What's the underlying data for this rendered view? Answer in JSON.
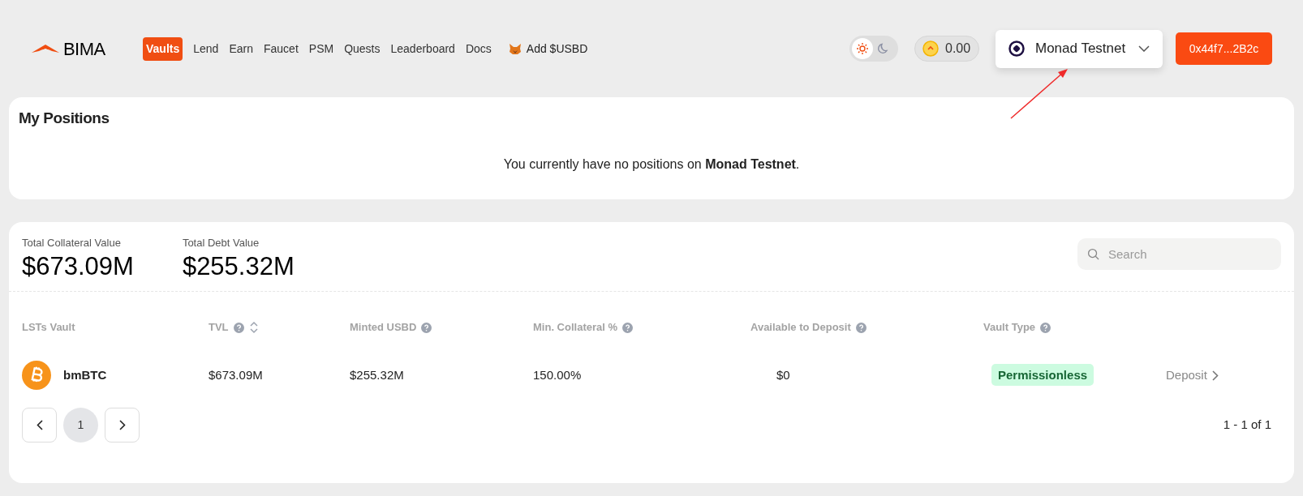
{
  "brand": "BIMA",
  "nav": [
    {
      "label": "Vaults",
      "selected": true
    },
    {
      "label": "Lend",
      "selected": false
    },
    {
      "label": "Earn",
      "selected": false
    },
    {
      "label": "Faucet",
      "selected": false
    },
    {
      "label": "PSM",
      "selected": false
    },
    {
      "label": "Quests",
      "selected": false
    },
    {
      "label": "Leaderboard",
      "selected": false
    },
    {
      "label": "Docs",
      "selected": false
    }
  ],
  "add_token": "Add $USBD",
  "dark_mode": false,
  "balance": "0.00",
  "network": "Monad Testnet",
  "wallet": "0x44f7...2B2c",
  "positions": {
    "title": "My Positions",
    "message": "You currently have no positions on **Monad Testnet**."
  },
  "stats": [
    {
      "label": "Total Collateral Value",
      "value": "$673.09M"
    },
    {
      "label": "Total Debt Value",
      "value": "$255.32M"
    }
  ],
  "search": {
    "placeholder": "Search"
  },
  "table": {
    "columns": [
      {
        "label": "LSTs Vault",
        "help": false,
        "sortable": false
      },
      {
        "label": "TVL",
        "help": true,
        "sortable": true
      },
      {
        "label": "Minted USBD",
        "help": true,
        "sortable": false
      },
      {
        "label": "Min. Collateral %",
        "help": true,
        "sortable": false
      },
      {
        "label": "Available to Deposit",
        "help": true,
        "sortable": false
      },
      {
        "label": "Vault Type",
        "help": true,
        "sortable": false
      }
    ],
    "rows": [
      {
        "vault": "bmBTC",
        "tvl": "$673.09M",
        "minted": "$255.32M",
        "min_collateral": "150.00%",
        "available": "$0",
        "vault_type": "Permissionless",
        "action": "Deposit"
      }
    ]
  },
  "pagination": {
    "pages": [
      {
        "label": "1",
        "selected": true
      }
    ],
    "summary": "1 - 1 of 1"
  }
}
